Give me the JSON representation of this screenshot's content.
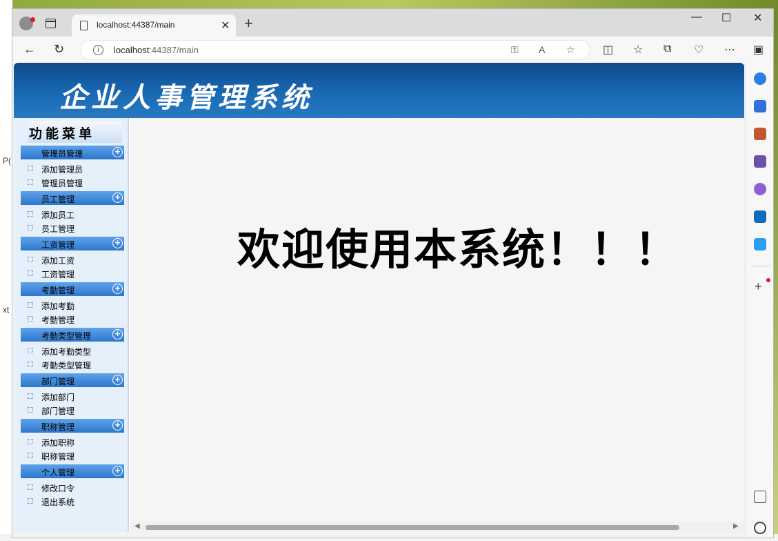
{
  "desktop": {
    "left_text_1": "P(",
    "left_text_2": "xt"
  },
  "browser": {
    "tab_title": "localhost:44387/main",
    "url_host": "localhost",
    "url_rest": ":44387/main",
    "window_controls": {
      "minimize": "—",
      "maximize": "☐",
      "close": "✕"
    }
  },
  "app": {
    "banner_title": "企业人事管理系统",
    "menu_title": "功能菜单",
    "groups": [
      {
        "label": "管理员管理",
        "items": [
          "添加管理员",
          "管理员管理"
        ]
      },
      {
        "label": "员工管理",
        "items": [
          "添加员工",
          "员工管理"
        ]
      },
      {
        "label": "工资管理",
        "items": [
          "添加工资",
          "工资管理"
        ]
      },
      {
        "label": "考勤管理",
        "items": [
          "添加考勤",
          "考勤管理"
        ]
      },
      {
        "label": "考勤类型管理",
        "items": [
          "添加考勤类型",
          "考勤类型管理"
        ]
      },
      {
        "label": "部门管理",
        "items": [
          "添加部门",
          "部门管理"
        ]
      },
      {
        "label": "职称管理",
        "items": [
          "添加职称",
          "职称管理"
        ]
      },
      {
        "label": "个人管理",
        "items": [
          "修改口令",
          "退出系统"
        ]
      }
    ],
    "welcome": "欢迎使用本系统！！！"
  },
  "colors": {
    "banner": "#1a69b3",
    "group_bar": "#2e77cc",
    "sidebar_bg": "#e6f0fb"
  }
}
